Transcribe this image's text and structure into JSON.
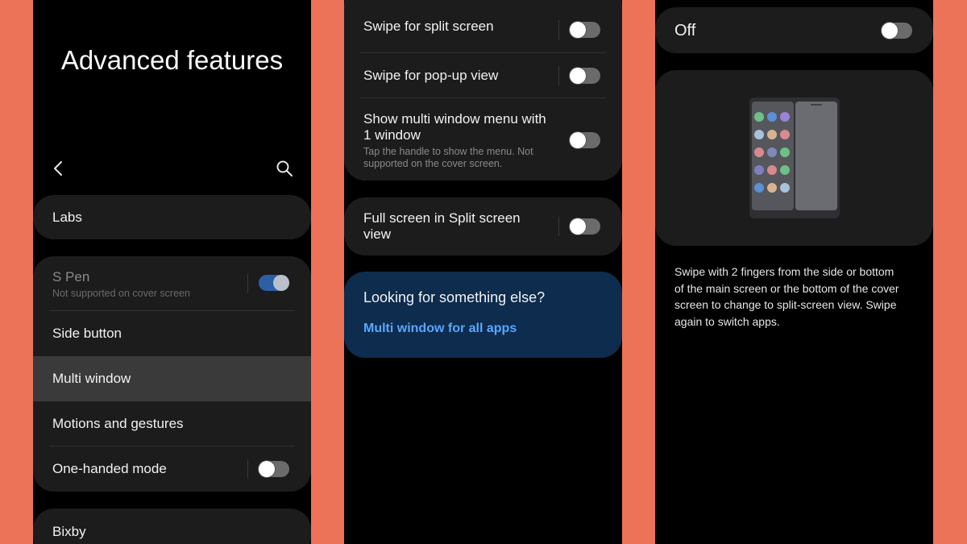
{
  "screen1": {
    "title": "Advanced features",
    "items": {
      "labs": "Labs",
      "spen": {
        "label": "S Pen",
        "sub": "Not supported on cover screen",
        "toggle": "on"
      },
      "side_button": "Side button",
      "multi_window": "Multi window",
      "motions": "Motions and gestures",
      "one_handed": {
        "label": "One-handed mode",
        "toggle": "off"
      },
      "bixby": "Bixby"
    }
  },
  "screen2": {
    "swipe_split": {
      "label": "Swipe for split screen",
      "toggle": "off"
    },
    "swipe_popup": {
      "label": "Swipe for pop-up view",
      "toggle": "off"
    },
    "show_menu": {
      "label_line1": "Show multi window menu with",
      "label_line2": "1 window",
      "sub_line1": "Tap the handle to show the menu. Not",
      "sub_line2": "supported on the cover screen.",
      "toggle": "off"
    },
    "full_screen": {
      "label_line1": "Full screen in Split screen",
      "label_line2": "view",
      "toggle": "off"
    },
    "suggest": {
      "heading": "Looking for something else?",
      "link": "Multi window for all apps"
    }
  },
  "screen3": {
    "master": {
      "label": "Off",
      "toggle": "off"
    },
    "description": [
      "Swipe with 2 fingers from the side or bottom",
      "of the main screen or the bottom of the cover",
      "screen to change to split-screen view. Swipe",
      "again to switch apps."
    ]
  },
  "colors": {
    "background": "#ec7357",
    "card": "#1c1c1c",
    "toggle_on": "#2d5fa5",
    "link": "#5aa6ff",
    "suggest_card": "#0d2c4e"
  }
}
